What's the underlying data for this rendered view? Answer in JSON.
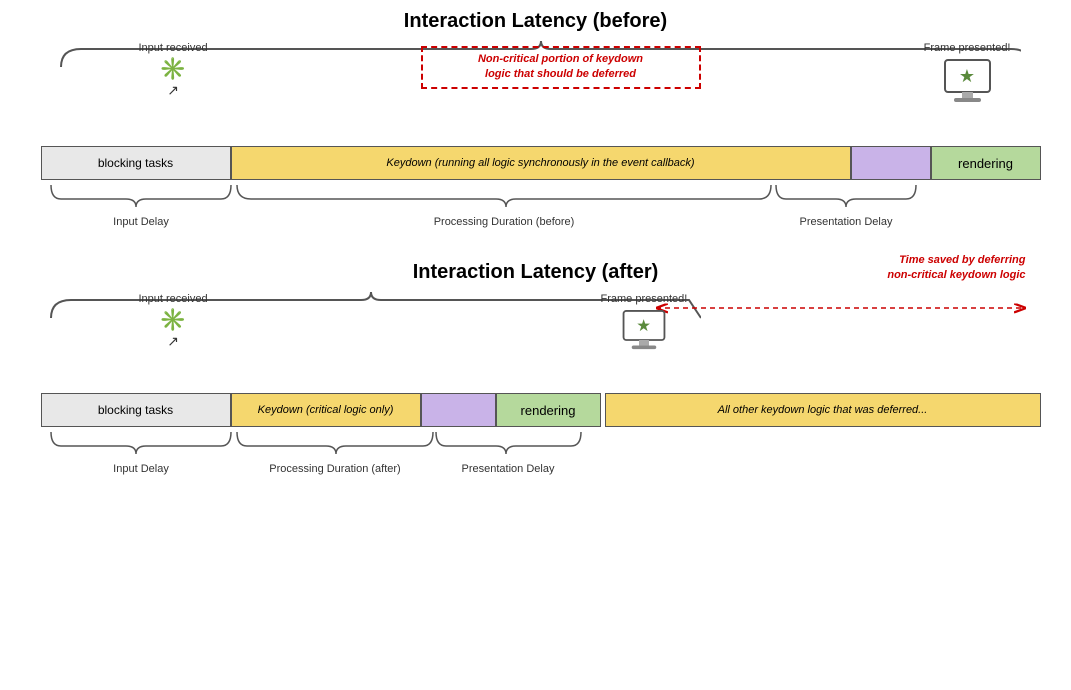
{
  "section1": {
    "title": "Interaction Latency (before)",
    "input_received_label": "Input received",
    "frame_presented_label": "Frame presented!",
    "block_blocking": "blocking tasks",
    "block_keydown": "Keydown (running all logic synchronously in the event callback)",
    "block_rendering": "rendering",
    "label_input_delay": "Input Delay",
    "label_processing": "Processing Duration (before)",
    "label_presentation": "Presentation Delay",
    "annotation_red": "Non-critical portion of keydown\nlogic that should be deferred"
  },
  "section2": {
    "title": "Interaction Latency (after)",
    "input_received_label": "Input received",
    "frame_presented_label": "Frame presented!",
    "block_blocking": "blocking tasks",
    "block_keydown": "Keydown (critical logic only)",
    "block_rendering": "rendering",
    "block_deferred": "All other keydown logic that was deferred...",
    "label_input_delay": "Input Delay",
    "label_processing": "Processing Duration (after)",
    "label_presentation": "Presentation Delay",
    "time_saved_label": "Time saved by deferring\nnon-critical keydown logic"
  }
}
